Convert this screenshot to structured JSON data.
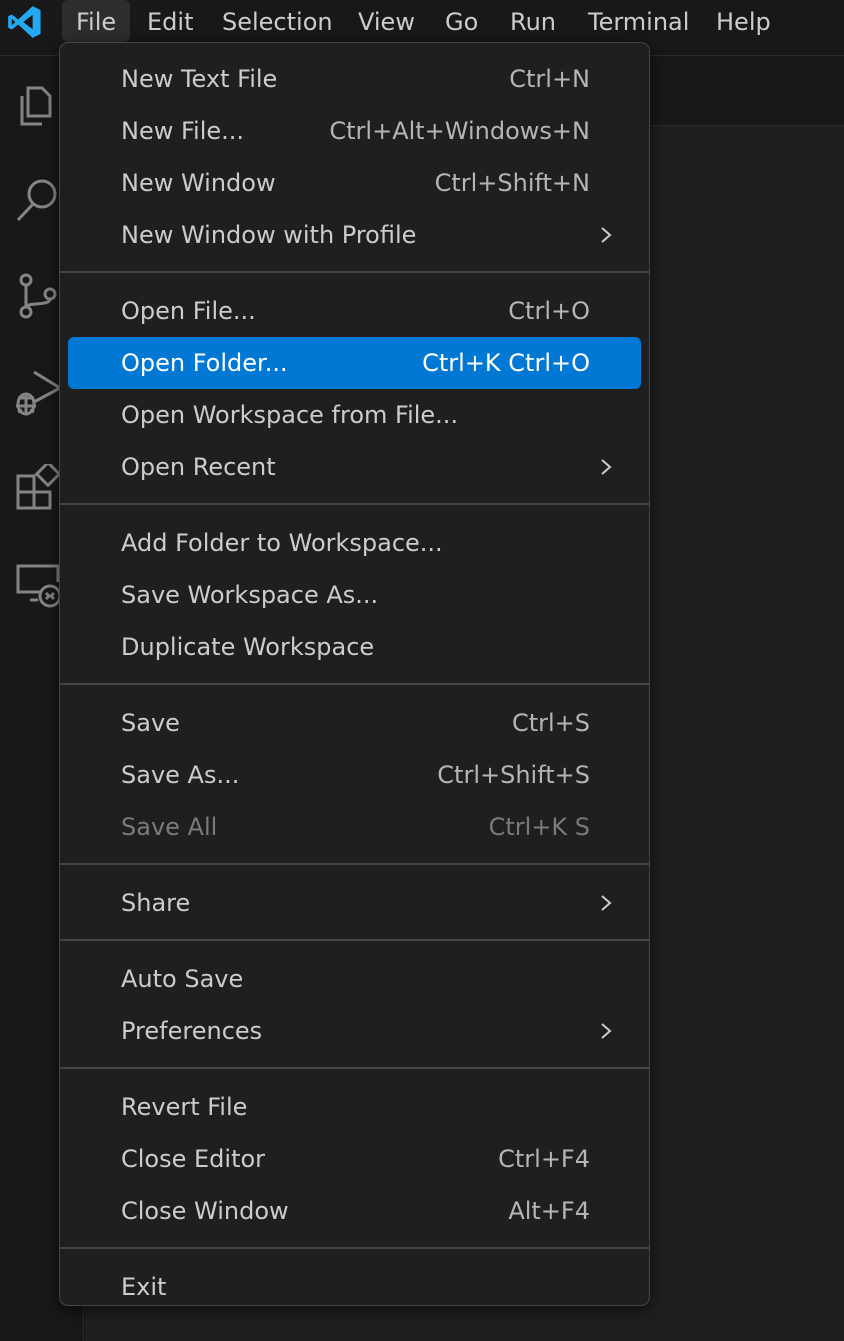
{
  "menubar": {
    "items": [
      {
        "label": "File",
        "active": true
      },
      {
        "label": "Edit"
      },
      {
        "label": "Selection"
      },
      {
        "label": "View"
      },
      {
        "label": "Go"
      },
      {
        "label": "Run"
      },
      {
        "label": "Terminal"
      },
      {
        "label": "Help"
      }
    ]
  },
  "activitybar": {
    "icons": [
      "explorer-icon",
      "search-icon",
      "source-control-icon",
      "run-debug-icon",
      "extensions-icon",
      "remote-explorer-icon"
    ]
  },
  "file_menu": {
    "groups": [
      [
        {
          "label": "New Text File",
          "shortcut": "Ctrl+N"
        },
        {
          "label": "New File...",
          "shortcut": "Ctrl+Alt+Windows+N"
        },
        {
          "label": "New Window",
          "shortcut": "Ctrl+Shift+N"
        },
        {
          "label": "New Window with Profile",
          "submenu": true
        }
      ],
      [
        {
          "label": "Open File...",
          "shortcut": "Ctrl+O"
        },
        {
          "label": "Open Folder...",
          "shortcut": "Ctrl+K Ctrl+O",
          "selected": true
        },
        {
          "label": "Open Workspace from File..."
        },
        {
          "label": "Open Recent",
          "submenu": true
        }
      ],
      [
        {
          "label": "Add Folder to Workspace..."
        },
        {
          "label": "Save Workspace As..."
        },
        {
          "label": "Duplicate Workspace"
        }
      ],
      [
        {
          "label": "Save",
          "shortcut": "Ctrl+S"
        },
        {
          "label": "Save As...",
          "shortcut": "Ctrl+Shift+S"
        },
        {
          "label": "Save All",
          "shortcut": "Ctrl+K S",
          "disabled": true
        }
      ],
      [
        {
          "label": "Share",
          "submenu": true
        }
      ],
      [
        {
          "label": "Auto Save"
        },
        {
          "label": "Preferences",
          "submenu": true
        }
      ],
      [
        {
          "label": "Revert File"
        },
        {
          "label": "Close Editor",
          "shortcut": "Ctrl+F4"
        },
        {
          "label": "Close Window",
          "shortcut": "Alt+F4"
        }
      ],
      [
        {
          "label": "Exit"
        }
      ]
    ]
  },
  "colors": {
    "accent": "#0078d4",
    "logo": "#23a9f2",
    "menu_bg": "#1f1f1f",
    "separator": "#454545"
  }
}
